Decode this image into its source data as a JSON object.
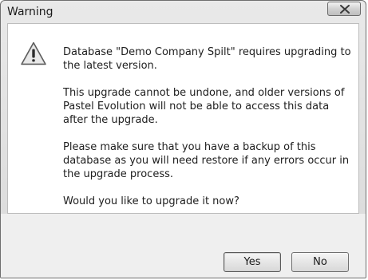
{
  "window": {
    "title": "Warning",
    "close_glyph": "X"
  },
  "message": {
    "icon": "warning-triangle-icon",
    "paragraphs": [
      "Database \"Demo Company Spilt\" requires upgrading to the latest version.",
      "This upgrade cannot be undone, and older versions of Pastel Evolution will not be able to access this data after the upgrade.",
      "Please make sure that you have a backup of this database as you will need restore if any errors occur in the upgrade process.",
      "Would you like to upgrade it now?"
    ]
  },
  "buttons": {
    "yes_label": "Yes",
    "no_label": "No"
  }
}
